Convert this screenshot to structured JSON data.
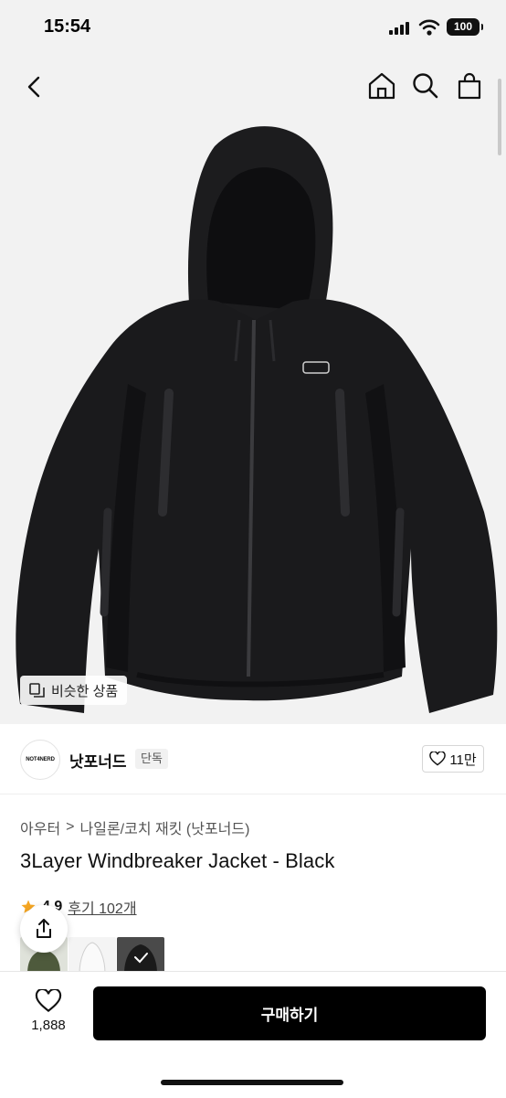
{
  "status_bar": {
    "time": "15:54",
    "battery": "100"
  },
  "similar_button": {
    "label": "비슷한 상품"
  },
  "brand": {
    "logo_text": "NOT4NERD",
    "name": "낫포너드",
    "badge": "단독",
    "likes": "11만"
  },
  "breadcrumb": {
    "category": "아우터",
    "separator": ">",
    "subcategory": "나일론/코치 재킷 (낫포너드)"
  },
  "product": {
    "title": "3Layer Windbreaker Jacket - Black",
    "rating": "4.9",
    "review_link": "후기 102개"
  },
  "thumbnails": [
    {
      "color": "khaki"
    },
    {
      "color": "white"
    },
    {
      "color": "black",
      "selected": true
    }
  ],
  "bottom_bar": {
    "wish_count": "1,888",
    "buy_label": "구매하기"
  },
  "colors": {
    "accent": "#000000",
    "star": "#f5a623",
    "image_background": "#f2f2f2"
  },
  "icons": [
    "back-icon",
    "home-icon",
    "search-icon",
    "bag-icon",
    "similar-icon",
    "heart-icon",
    "star-icon",
    "share-icon",
    "check-icon"
  ]
}
